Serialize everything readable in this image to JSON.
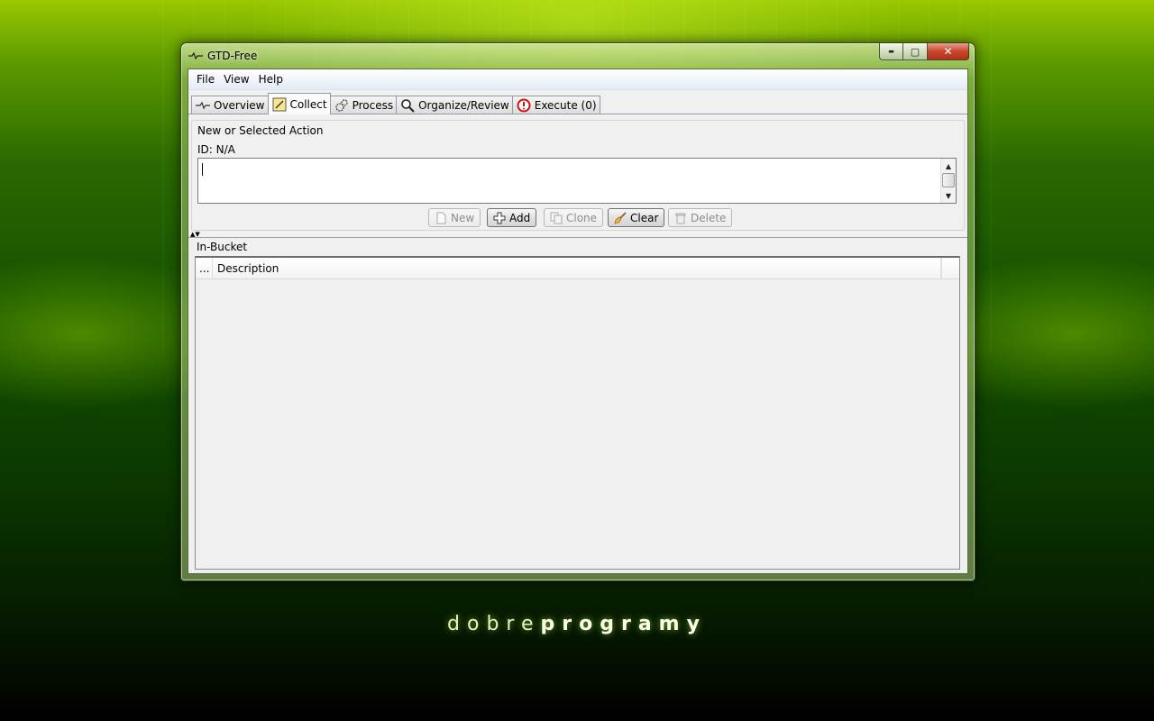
{
  "window": {
    "title": "GTD-Free",
    "minimize_glyph": "▬",
    "maximize_glyph": "▢",
    "close_glyph": "✕"
  },
  "menu": {
    "items": [
      "File",
      "View",
      "Help"
    ]
  },
  "tabs": [
    {
      "label": "Overview",
      "icon": "overview-icon",
      "active": false
    },
    {
      "label": "Collect",
      "icon": "note-icon",
      "active": true
    },
    {
      "label": "Process",
      "icon": "gears-icon",
      "active": false
    },
    {
      "label": "Organize/Review",
      "icon": "magnifier-icon",
      "active": false
    },
    {
      "label": "Execute (0)",
      "icon": "stop-icon",
      "active": false
    }
  ],
  "action_panel": {
    "group_title": "New or Selected Action",
    "id_label": "ID: N/A",
    "text_value": "",
    "buttons": {
      "new": {
        "label": "New",
        "enabled": false
      },
      "add": {
        "label": "Add",
        "enabled": true
      },
      "clone": {
        "label": "Clone",
        "enabled": false
      },
      "clear": {
        "label": "Clear",
        "enabled": true
      },
      "delete": {
        "label": "Delete",
        "enabled": false
      }
    }
  },
  "bucket": {
    "title": "In-Bucket",
    "columns": [
      "...",
      "Description"
    ],
    "rows": []
  },
  "branding": {
    "light": "dobre",
    "bold": "programy"
  },
  "colors": {
    "close_red": "#c8462c",
    "execute_red": "#cc1111",
    "accent_green": "#5c9a00"
  }
}
